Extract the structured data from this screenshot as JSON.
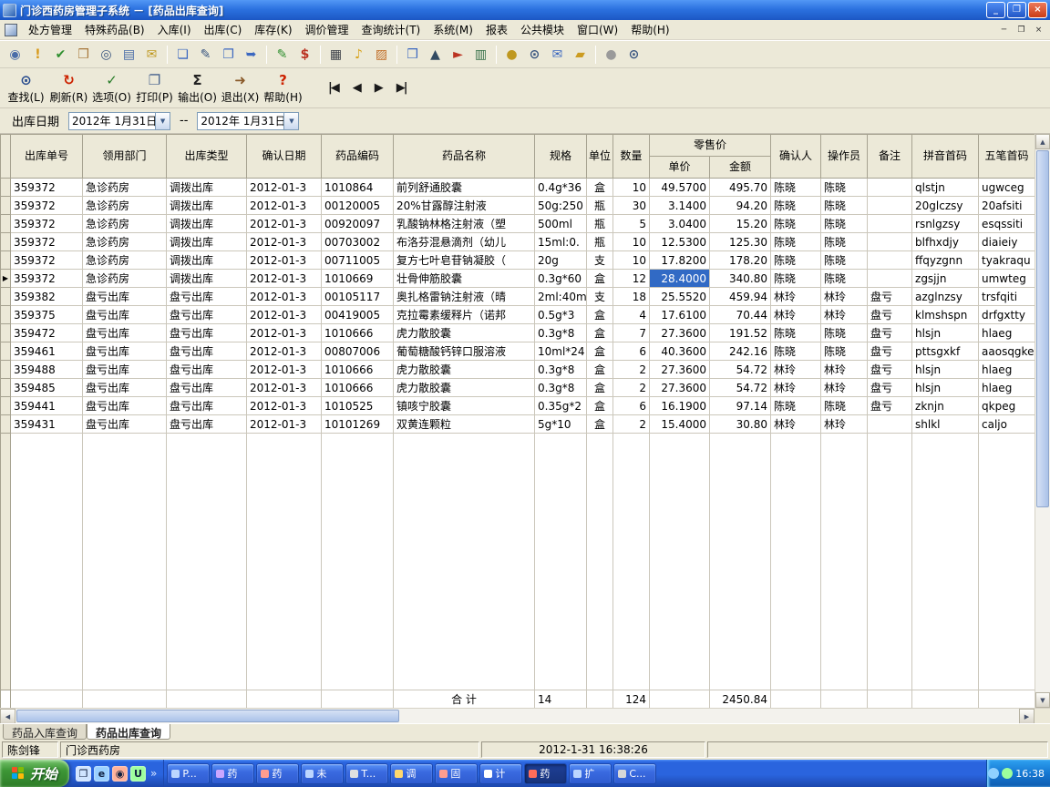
{
  "titlebar": {
    "title": "门诊西药房管理子系统 － [药品出库查询]",
    "controls": {
      "minimize": "_",
      "restore": "❐",
      "close": "×"
    }
  },
  "menubar": {
    "items": [
      "处方管理",
      "特殊药品(B)",
      "入库(I)",
      "出库(C)",
      "库存(K)",
      "调价管理",
      "查询统计(T)",
      "系统(M)",
      "报表",
      "公共模块",
      "窗口(W)",
      "帮助(H)"
    ],
    "mdi_controls": {
      "minimize": "─",
      "restore": "❐",
      "close": "×"
    }
  },
  "icon_toolbar": {
    "icons": [
      {
        "name": "find-record-icon",
        "glyph": "◉",
        "color": "#4a6ca8"
      },
      {
        "name": "alert-icon",
        "glyph": "!",
        "color": "#d89a1c"
      },
      {
        "name": "approve-icon",
        "glyph": "✔",
        "color": "#2f8f2f"
      },
      {
        "name": "notebook-icon",
        "glyph": "❒",
        "color": "#a8783c"
      },
      {
        "name": "browse-icon",
        "glyph": "◎",
        "color": "#3a5680"
      },
      {
        "name": "clipboard-icon",
        "glyph": "▤",
        "color": "#4a6ca8"
      },
      {
        "name": "mail-icon",
        "glyph": "✉",
        "color": "#bf9820"
      },
      {
        "name": "new-doc-icon",
        "glyph": "❏",
        "color": "#3c68c0"
      },
      {
        "name": "edit-doc-icon",
        "glyph": "✎",
        "color": "#3a5680"
      },
      {
        "name": "copy-doc-icon",
        "glyph": "❐",
        "color": "#3c68c0"
      },
      {
        "name": "post-doc-icon",
        "glyph": "➥",
        "color": "#3c68c0"
      },
      {
        "name": "report-chart-icon",
        "glyph": "✎",
        "color": "#2f8f2f"
      },
      {
        "name": "money-icon",
        "glyph": "$",
        "color": "#bb3322"
      },
      {
        "name": "grid-icon",
        "glyph": "▦",
        "color": "#3c4048"
      },
      {
        "name": "bell-icon",
        "glyph": "♪",
        "color": "#d8a31c"
      },
      {
        "name": "picture-icon",
        "glyph": "▨",
        "color": "#c2702a"
      },
      {
        "name": "package-icon",
        "glyph": "❒",
        "color": "#3c68c0"
      },
      {
        "name": "ship-icon",
        "glyph": "▲",
        "color": "#324a62"
      },
      {
        "name": "flag-icon",
        "glyph": "►",
        "color": "#bb3322"
      },
      {
        "name": "books-icon",
        "glyph": "▥",
        "color": "#357048"
      },
      {
        "name": "key-icon",
        "glyph": "●",
        "color": "#bf9820"
      },
      {
        "name": "search-icon",
        "glyph": "⊙",
        "color": "#3a5680"
      },
      {
        "name": "mail-send-icon",
        "glyph": "✉",
        "color": "#3c68c0"
      },
      {
        "name": "folder-icon",
        "glyph": "▰",
        "color": "#cc9c22"
      },
      {
        "name": "disabled-circle-icon",
        "glyph": "●",
        "color": "#9a9a9a"
      },
      {
        "name": "zoom-icon",
        "glyph": "⊙",
        "color": "#3a5680"
      }
    ],
    "separators_after": [
      6,
      10,
      12,
      15,
      19,
      23
    ]
  },
  "action_toolbar": {
    "buttons": [
      {
        "name": "find",
        "label": "查找(L)",
        "glyph": "⊙",
        "color": "#24488c"
      },
      {
        "name": "refresh",
        "label": "刷新(R)",
        "glyph": "↻",
        "color": "#cc2200"
      },
      {
        "name": "options",
        "label": "选项(O)",
        "glyph": "✓",
        "color": "#2a7d2a"
      },
      {
        "name": "print",
        "label": "打印(P)",
        "glyph": "❐",
        "color": "#44608c"
      },
      {
        "name": "export",
        "label": "输出(O)",
        "glyph": "Σ",
        "color": "#222222"
      },
      {
        "name": "exit",
        "label": "退出(X)",
        "glyph": "➜",
        "color": "#8a5a2a"
      },
      {
        "name": "help",
        "label": "帮助(H)",
        "glyph": "?",
        "color": "#cc2200"
      }
    ],
    "nav": [
      "|◀",
      "◀",
      "▶",
      "▶|"
    ]
  },
  "filter": {
    "label": "出库日期",
    "date_from": "2012年 1月31日",
    "separator": "--",
    "date_to": "2012年 1月31日",
    "dropdown_glyph": "▼"
  },
  "table": {
    "group_header": "零售价",
    "columns": [
      {
        "key": "doc_no",
        "label": "出库单号",
        "width": 79,
        "align": "left"
      },
      {
        "key": "dept",
        "label": "领用部门",
        "width": 92,
        "align": "left"
      },
      {
        "key": "out_type",
        "label": "出库类型",
        "width": 88,
        "align": "left"
      },
      {
        "key": "confirm_date",
        "label": "确认日期",
        "width": 82,
        "align": "left"
      },
      {
        "key": "drug_code",
        "label": "药品编码",
        "width": 79,
        "align": "left"
      },
      {
        "key": "drug_name",
        "label": "药品名称",
        "width": 155,
        "align": "left"
      },
      {
        "key": "spec",
        "label": "规格",
        "width": 57,
        "align": "left"
      },
      {
        "key": "unit",
        "label": "单位",
        "width": 29,
        "align": "center"
      },
      {
        "key": "qty",
        "label": "数量",
        "width": 40,
        "align": "right"
      },
      {
        "key": "unit_price",
        "label": "单价",
        "width": 66,
        "align": "right",
        "group": true
      },
      {
        "key": "amount",
        "label": "金额",
        "width": 67,
        "align": "right",
        "group": true
      },
      {
        "key": "confirmer",
        "label": "确认人",
        "width": 55,
        "align": "left"
      },
      {
        "key": "operator",
        "label": "操作员",
        "width": 51,
        "align": "left"
      },
      {
        "key": "remark",
        "label": "备注",
        "width": 49,
        "align": "left"
      },
      {
        "key": "pinyin",
        "label": "拼音首码",
        "width": 73,
        "align": "left"
      },
      {
        "key": "wubi",
        "label": "五笔首码",
        "width": 62,
        "align": "left"
      }
    ],
    "rows": [
      [
        "359372",
        "急诊药房",
        "调拨出库",
        "2012-01-3",
        "1010864",
        "前列舒通胶囊",
        "0.4g*36",
        "盒",
        "10",
        "49.5700",
        "495.70",
        "陈晓",
        "陈晓",
        "",
        "qlstjn",
        "ugwceg"
      ],
      [
        "359372",
        "急诊药房",
        "调拨出库",
        "2012-01-3",
        "00120005",
        "20%甘露醇注射液",
        "50g:250",
        "瓶",
        "30",
        "3.1400",
        "94.20",
        "陈晓",
        "陈晓",
        "",
        "20glczsy",
        "20afsiti"
      ],
      [
        "359372",
        "急诊药房",
        "调拨出库",
        "2012-01-3",
        "00920097",
        "乳酸钠林格注射液（塑",
        "500ml",
        "瓶",
        "5",
        "3.0400",
        "15.20",
        "陈晓",
        "陈晓",
        "",
        "rsnlgzsy",
        "esqssiti"
      ],
      [
        "359372",
        "急诊药房",
        "调拨出库",
        "2012-01-3",
        "00703002",
        "布洛芬混悬滴剂（幼儿",
        "15ml:0.",
        "瓶",
        "10",
        "12.5300",
        "125.30",
        "陈晓",
        "陈晓",
        "",
        "blfhxdjy",
        "diaieiy"
      ],
      [
        "359372",
        "急诊药房",
        "调拨出库",
        "2012-01-3",
        "00711005",
        "复方七叶皂苷钠凝胶（",
        "20g",
        "支",
        "10",
        "17.8200",
        "178.20",
        "陈晓",
        "陈晓",
        "",
        "ffqyzgnn",
        "tyakraqu"
      ],
      [
        "359372",
        "急诊药房",
        "调拨出库",
        "2012-01-3",
        "1010669",
        "壮骨伸筋胶囊",
        "0.3g*60",
        "盒",
        "12",
        "28.4000",
        "340.80",
        "陈晓",
        "陈晓",
        "",
        "zgsjjn",
        "umwteg"
      ],
      [
        "359382",
        "盘亏出库",
        "盘亏出库",
        "2012-01-3",
        "00105117",
        "奥扎格雷钠注射液（晴",
        "2ml:40m",
        "支",
        "18",
        "25.5520",
        "459.94",
        "林玲",
        "林玲",
        "盘亏",
        "azglnzsy",
        "trsfqiti"
      ],
      [
        "359375",
        "盘亏出库",
        "盘亏出库",
        "2012-01-3",
        "00419005",
        "克拉霉素缓释片（诺邦",
        "0.5g*3",
        "盒",
        "4",
        "17.6100",
        "70.44",
        "林玲",
        "林玲",
        "盘亏",
        "klmshspn",
        "drfgxtty"
      ],
      [
        "359472",
        "盘亏出库",
        "盘亏出库",
        "2012-01-3",
        "1010666",
        "虎力散胶囊",
        "0.3g*8",
        "盒",
        "7",
        "27.3600",
        "191.52",
        "陈晓",
        "陈晓",
        "盘亏",
        "hlsjn",
        "hlaeg"
      ],
      [
        "359461",
        "盘亏出库",
        "盘亏出库",
        "2012-01-3",
        "00807006",
        "葡萄糖酸钙锌口服溶液",
        "10ml*24",
        "盒",
        "6",
        "40.3600",
        "242.16",
        "陈晓",
        "陈晓",
        "盘亏",
        "pttsgxkf",
        "aaosqgke"
      ],
      [
        "359488",
        "盘亏出库",
        "盘亏出库",
        "2012-01-3",
        "1010666",
        "虎力散胶囊",
        "0.3g*8",
        "盒",
        "2",
        "27.3600",
        "54.72",
        "林玲",
        "林玲",
        "盘亏",
        "hlsjn",
        "hlaeg"
      ],
      [
        "359485",
        "盘亏出库",
        "盘亏出库",
        "2012-01-3",
        "1010666",
        "虎力散胶囊",
        "0.3g*8",
        "盒",
        "2",
        "27.3600",
        "54.72",
        "林玲",
        "林玲",
        "盘亏",
        "hlsjn",
        "hlaeg"
      ],
      [
        "359441",
        "盘亏出库",
        "盘亏出库",
        "2012-01-3",
        "1010525",
        "镇咳宁胶囊",
        "0.35g*2",
        "盒",
        "6",
        "16.1900",
        "97.14",
        "陈晓",
        "陈晓",
        "盘亏",
        "zknjn",
        "qkpeg"
      ],
      [
        "359431",
        "盘亏出库",
        "盘亏出库",
        "2012-01-3",
        "10101269",
        "双黄连颗粒",
        "5g*10",
        "盒",
        "2",
        "15.4000",
        "30.80",
        "林玲",
        "林玲",
        "",
        "shlkl",
        "caljo"
      ]
    ],
    "selected": {
      "row": 5,
      "column": "unit_price",
      "indicator_glyph": "▶"
    },
    "footer": {
      "label": "合  计",
      "row_count": "14",
      "qty_total": "124",
      "amount_total": "2450.84"
    }
  },
  "scrollbars": {
    "up": "▲",
    "down": "▼",
    "left": "◀",
    "right": "▶"
  },
  "tabs": [
    {
      "label": "药品入库查询",
      "active": false
    },
    {
      "label": "药品出库查询",
      "active": true
    }
  ],
  "statusbar": {
    "user": "陈剑锋",
    "department": "门诊西药房",
    "datetime": "2012-1-31 16:38:26"
  },
  "taskbar": {
    "start_label": "开始",
    "quick_launch": [
      {
        "name": "show-desktop-icon",
        "glyph": "❐",
        "color": "#cfe4ff"
      },
      {
        "name": "ie-browser-icon",
        "glyph": "e",
        "color": "#9ad0ff"
      },
      {
        "name": "media-player-icon",
        "glyph": "◉",
        "color": "#ffb199"
      },
      {
        "name": "uc-browser-icon",
        "glyph": "U",
        "color": "#9dff9d"
      }
    ],
    "chevron": "»",
    "tasks": [
      {
        "label": "P...",
        "color": "#bcd6ff",
        "active": false
      },
      {
        "label": "药",
        "color": "#caa7ff",
        "active": false
      },
      {
        "label": "药",
        "color": "#ff9d8f",
        "active": false
      },
      {
        "label": "未",
        "color": "#bcd6ff",
        "active": false
      },
      {
        "label": "T...",
        "color": "#e0e0e0",
        "active": false
      },
      {
        "label": "调",
        "color": "#ffd76e",
        "active": false
      },
      {
        "label": "固",
        "color": "#ff9d8f",
        "active": false
      },
      {
        "label": "计",
        "color": "#ffffff",
        "active": false
      },
      {
        "label": "药",
        "color": "#ff6d5a",
        "active": true
      },
      {
        "label": "扩",
        "color": "#bcd6ff",
        "active": false
      },
      {
        "label": "C...",
        "color": "#d8d8d8",
        "active": false
      }
    ],
    "tray": {
      "icons": [
        {
          "name": "network-icon",
          "color": "#8fd0ff"
        },
        {
          "name": "safety-icon",
          "color": "#9dff9d"
        }
      ],
      "time": "16:38"
    }
  }
}
